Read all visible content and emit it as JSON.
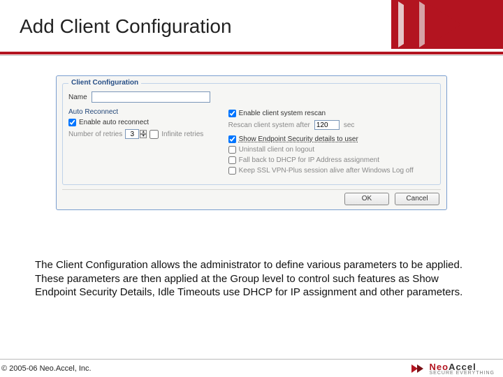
{
  "header": {
    "title": "Add Client Configuration"
  },
  "panel": {
    "legend": "Client Configuration",
    "name_label": "Name",
    "name_value": "",
    "left": {
      "heading": "Auto Reconnect",
      "enable_label": "Enable auto reconnect",
      "enable_checked": true,
      "retries_label": "Number of retries",
      "retries_value": "3",
      "infinite_label": "Infinite retries",
      "infinite_checked": false
    },
    "right": {
      "enable_rescan_label": "Enable client system rescan",
      "enable_rescan_checked": true,
      "rescan_after_label": "Rescan client system after",
      "rescan_after_value": "120",
      "rescan_after_unit": "sec",
      "show_eps_label": "Show Endpoint Security details to user",
      "show_eps_checked": true,
      "uninstall_label": "Uninstall client on logout",
      "uninstall_checked": false,
      "dhcp_label": "Fall back to DHCP for IP Address assignment",
      "dhcp_checked": false,
      "keep_session_label": "Keep SSL VPN-Plus session alive after Windows Log off",
      "keep_session_checked": false
    },
    "buttons": {
      "ok": "OK",
      "cancel": "Cancel"
    }
  },
  "description": "The Client Configuration allows the administrator to define various parameters to be applied. These parameters are then applied at the Group level to control such features as Show Endpoint Security Details, Idle Timeouts use DHCP for IP assignment and other parameters.",
  "footer": {
    "copyright": "© 2005-06 Neo.Accel, Inc.",
    "brand_main": "Neo",
    "brand_accent": "Accel",
    "brand_tag": "SECURE EVERYTHING"
  }
}
